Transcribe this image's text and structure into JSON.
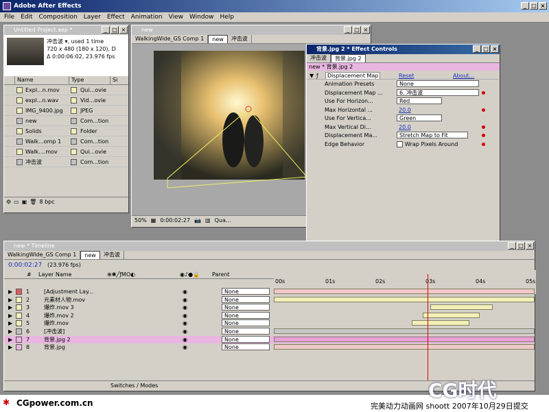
{
  "app": {
    "title": "Adobe After Effects"
  },
  "menu": [
    "File",
    "Edit",
    "Composition",
    "Layer",
    "Effect",
    "Animation",
    "View",
    "Window",
    "Help"
  ],
  "project": {
    "title": "Untitled Project.aep *",
    "info": {
      "name": "冲击波 ▾, used 1 time",
      "size": "720 x 480  (180 x 120), D",
      "duration": "Δ 0:00:06:02, 23.976 fps"
    },
    "headers": {
      "name": "Name",
      "type": "Type",
      "size": "Si"
    },
    "items": [
      {
        "name": "Expl...n.mov",
        "type": "Qui...ovie",
        "color": "#f2efb8"
      },
      {
        "name": "expl...n.wav",
        "type": "Vid...ovie",
        "color": "#f2efb8"
      },
      {
        "name": "IMG_9400.jpg",
        "type": "JPEG",
        "color": "#f2efb8"
      },
      {
        "name": "new",
        "type": "Com...tion",
        "color": "#c0c0c0"
      },
      {
        "name": "Solids",
        "type": "Folder",
        "color": "#f2efb8"
      },
      {
        "name": "Walk...omp 1",
        "type": "Com...tion",
        "color": "#c0c0c0"
      },
      {
        "name": "Walk....mov",
        "type": "Qui...ovie",
        "color": "#f2efb8"
      },
      {
        "name": "冲击波",
        "type": "Com...tion",
        "color": "#c0c0c0"
      }
    ],
    "bpc": "8 bpc"
  },
  "comp": {
    "title": "new",
    "tabs": [
      "WalkingWide_GS Comp 1",
      "new",
      "冲击波"
    ],
    "zoom": "50%",
    "time": "0:00:02:27",
    "quality": "Qua..."
  },
  "effect": {
    "title": "背景.jpg 2 * Effect Controls",
    "tabs": [
      "冲击波",
      "背景.jpg 2"
    ],
    "layer": "new * 背景.jpg 2",
    "effect_name": "Displacement Map",
    "reset": "Reset",
    "about": "About...",
    "props": [
      {
        "label": "Animation Presets",
        "value": "None"
      },
      {
        "label": "Displacement Map ...",
        "value": "6. 冲击波"
      },
      {
        "label": "Use For Horizon...",
        "value": "Red"
      },
      {
        "label": "Max Horizontal ...",
        "value": "20.0"
      },
      {
        "label": "Use For Vertica...",
        "value": "Green"
      },
      {
        "label": "Max Vertical Di...",
        "value": "20.0"
      },
      {
        "label": "Displacement Ma...",
        "value": "Stretch Map to Fit"
      },
      {
        "label": "Edge Behavior",
        "value": "Wrap Pixels Around"
      }
    ]
  },
  "timeline": {
    "title": "new * Timeline",
    "tabs": [
      "WalkingWide_GS Comp 1",
      "new",
      "冲击波"
    ],
    "time": "0:00:02:27",
    "fps": "(23.976 fps)",
    "col_layer": "Layer Name",
    "col_parent": "Parent",
    "col_num": "#",
    "ruler": [
      "00s",
      "01s",
      "02s",
      "03s",
      "04s",
      "05s"
    ],
    "switches": "Switches / Modes",
    "layers": [
      {
        "num": "1",
        "name": "[Adjustment Lay...",
        "color": "#d96060",
        "parent": "None",
        "bar": "pink",
        "s": 0,
        "e": 1
      },
      {
        "num": "2",
        "name": "元素材人物.mov",
        "color": "#f2efb8",
        "parent": "None",
        "bar": "ylw",
        "s": 0,
        "e": 1
      },
      {
        "num": "3",
        "name": "爆炸.mov 3",
        "color": "#f2efb8",
        "parent": "None",
        "bar": "ylw",
        "s": 0.6,
        "e": 0.84
      },
      {
        "num": "4",
        "name": "爆炸.mov 2",
        "color": "#f2efb8",
        "parent": "None",
        "bar": "ylw",
        "s": 0.57,
        "e": 0.79
      },
      {
        "num": "5",
        "name": "爆炸.mov",
        "color": "#f2efb8",
        "parent": "None",
        "bar": "ylw",
        "s": 0.53,
        "e": 0.75
      },
      {
        "num": "6",
        "name": "[冲击波]",
        "color": "#c0c0c0",
        "parent": "None",
        "bar": "gray",
        "s": 0,
        "e": 1
      },
      {
        "num": "7",
        "name": "背景.jpg 2",
        "color": "#e8b6e0",
        "parent": "None",
        "bar": "pinkdark",
        "s": 0,
        "e": 1
      },
      {
        "num": "8",
        "name": "背景.jpg",
        "color": "#e8b6e0",
        "parent": "None",
        "bar": "pink",
        "s": 0,
        "e": 1
      }
    ]
  },
  "footer": {
    "left": "CGpower.com.cn",
    "right": "完美动力动画网 shoott 2007年10月29日提交",
    "logo": "CG时代"
  }
}
